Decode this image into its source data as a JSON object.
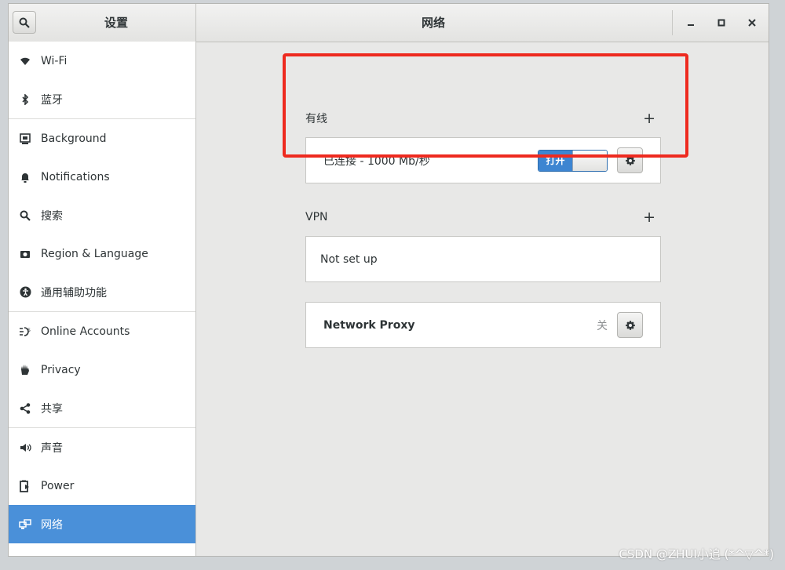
{
  "window": {
    "settings_title": "设置",
    "panel_title": "网络",
    "minimize_label": "–",
    "maximize_label": "▫",
    "close_label": "×"
  },
  "sidebar": {
    "items": [
      {
        "label": "Wi-Fi",
        "icon": "wifi-icon"
      },
      {
        "label": "蓝牙",
        "icon": "bluetooth-icon"
      },
      {
        "label": "Background",
        "icon": "background-icon"
      },
      {
        "label": "Notifications",
        "icon": "bell-icon"
      },
      {
        "label": "搜索",
        "icon": "search-icon"
      },
      {
        "label": "Region & Language",
        "icon": "camera-icon"
      },
      {
        "label": "通用辅助功能",
        "icon": "accessibility-icon"
      },
      {
        "label": "Online Accounts",
        "icon": "online-accounts-icon"
      },
      {
        "label": "Privacy",
        "icon": "hand-icon"
      },
      {
        "label": "共享",
        "icon": "share-icon"
      },
      {
        "label": "声音",
        "icon": "speaker-icon"
      },
      {
        "label": "Power",
        "icon": "power-icon"
      },
      {
        "label": "网络",
        "icon": "network-icon",
        "selected": true
      }
    ]
  },
  "wired": {
    "heading": "有线",
    "add_label": "+",
    "status": "已连接 - 1000 Mb/秒",
    "switch_label": "打开",
    "switch_on": true
  },
  "vpn": {
    "heading": "VPN",
    "add_label": "+",
    "status": "Not set up"
  },
  "proxy": {
    "label": "Network Proxy",
    "state": "关"
  },
  "watermark": "CSDN @ZHUI小追 (*^▽^*)",
  "colors": {
    "selection": "#4a90d9",
    "switch_on": "#3d85d1",
    "highlight_box": "#ee2a1f"
  }
}
